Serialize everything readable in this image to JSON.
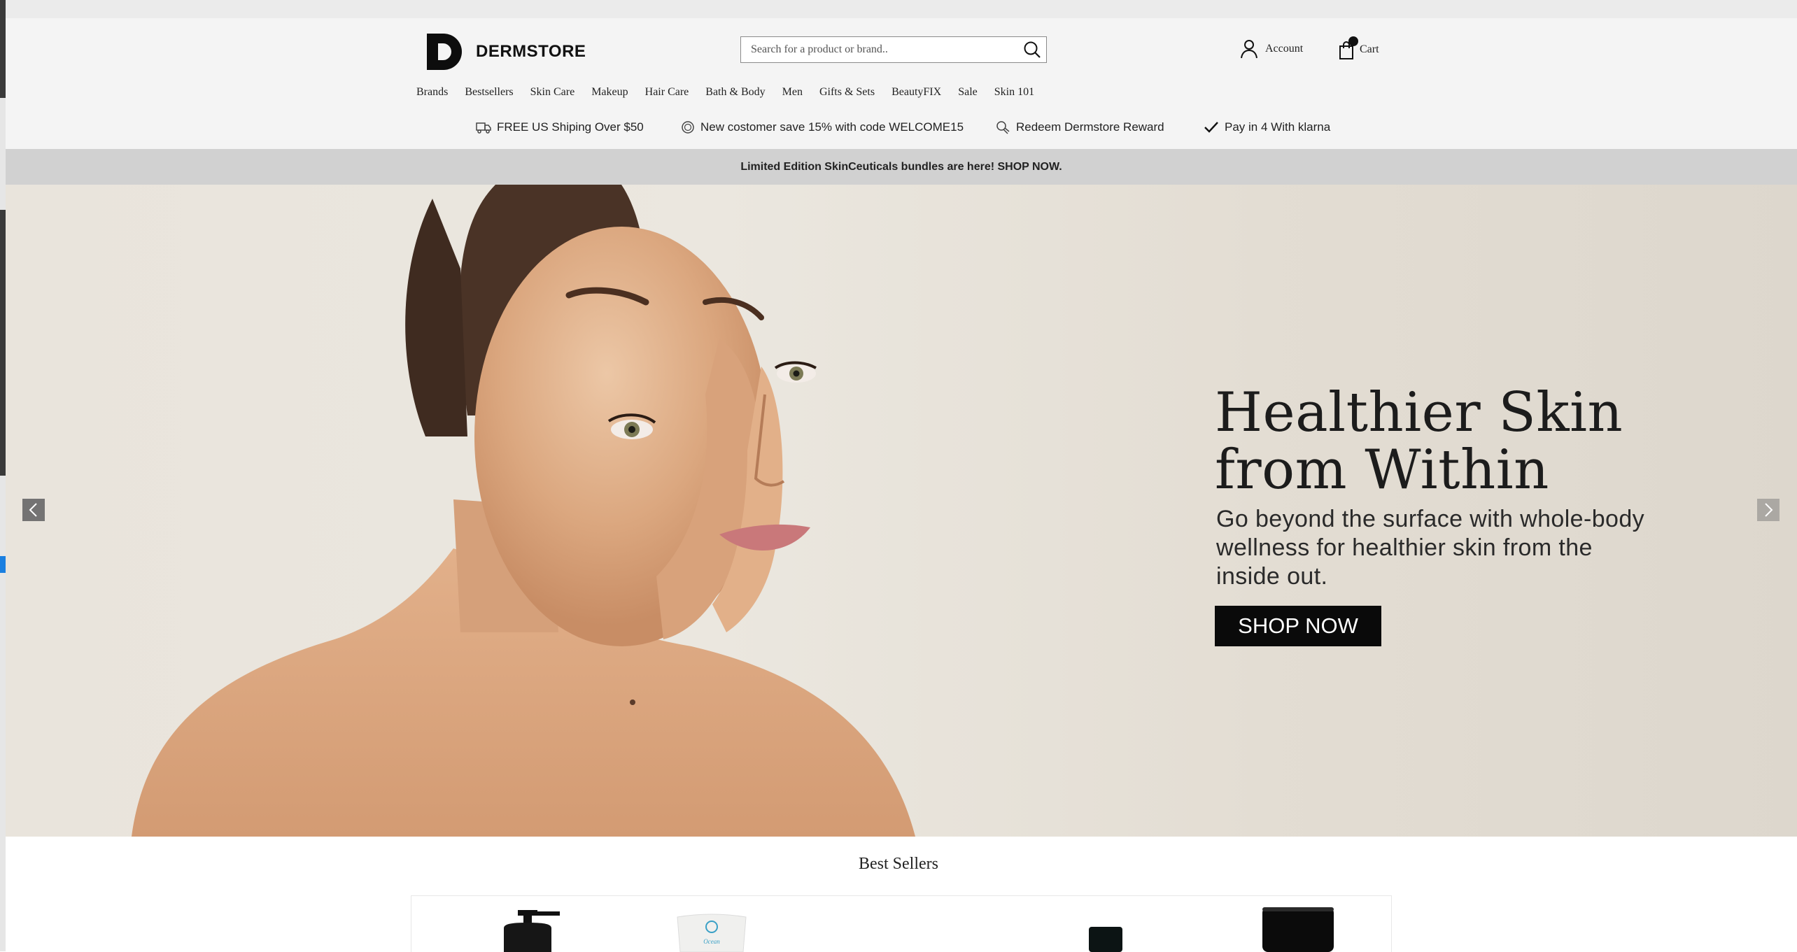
{
  "brand": {
    "name": "DERMSTORE"
  },
  "search": {
    "placeholder": "Search for a product or brand.."
  },
  "header": {
    "account_label": "Account",
    "cart_label": "Cart"
  },
  "nav": {
    "items": [
      "Brands",
      "Bestsellers",
      "Skin Care",
      "Makeup",
      "Hair Care",
      "Bath & Body",
      "Men",
      "Gifts & Sets",
      "BeautyFIX",
      "Sale",
      "Skin 101"
    ]
  },
  "benefits": [
    {
      "label": "FREE US Shiping Over $50",
      "icon": "truck-icon"
    },
    {
      "label": "New costomer save 15% with code WELCOME15",
      "icon": "badge-icon"
    },
    {
      "label": "Redeem Dermstore Reward",
      "icon": "reward-icon"
    },
    {
      "label": "Pay in 4 With klarna",
      "icon": "check-icon"
    }
  ],
  "promo": {
    "text": "Limited Edition SkinCeuticals bundles are here! SHOP NOW."
  },
  "hero": {
    "title": "Healthier Skin\nfrom Within",
    "subtitle": "Go beyond the surface with whole-body wellness for healthier skin from the inside out.",
    "cta": "SHOP NOW"
  },
  "best_sellers": {
    "title": "Best Sellers"
  },
  "colors": {
    "accent": "#0a0a0a",
    "header_bg": "#f4f4f4",
    "promo_bg": "#d1d1d1",
    "hero_bg": "#e9e4dc"
  }
}
